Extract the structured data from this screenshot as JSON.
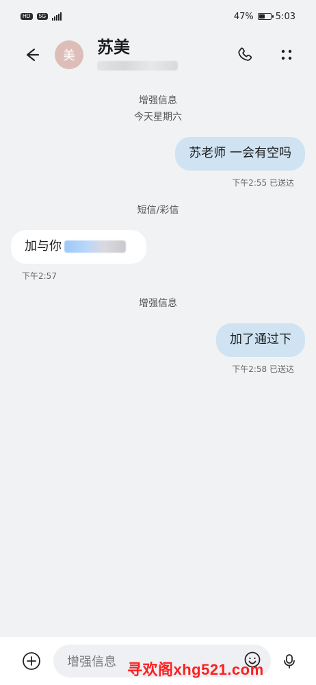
{
  "status_bar": {
    "hd": "HD",
    "network": "5G",
    "battery_percent": "47%",
    "time": "5:03",
    "battery_level": 0.47
  },
  "header": {
    "back_icon": "back-arrow-icon",
    "avatar_text": "美",
    "contact_name": "苏美",
    "phone_icon": "phone-icon",
    "more_icon": "more-vertical-icon",
    "avatar_color": "#dcbdb7"
  },
  "chat": {
    "labels": {
      "channel_enhanced_1": "增强信息",
      "day_label": "今天星期六",
      "channel_sms_mms": "短信/彩信",
      "channel_enhanced_2": "增强信息"
    },
    "messages": [
      {
        "direction": "outgoing",
        "text": "苏老师 一会有空吗",
        "meta": "下午2:55  已送达"
      },
      {
        "direction": "incoming",
        "text": "加与你",
        "meta": "下午2:57"
      },
      {
        "direction": "outgoing",
        "text": "加了通过下",
        "meta": "下午2:58  已送达"
      }
    ],
    "colors": {
      "outgoing_bubble": "#cfe3f2",
      "incoming_bubble": "#ffffff",
      "background": "#f1f2f4"
    }
  },
  "composer": {
    "plus_icon": "plus-circle-icon",
    "placeholder": "增强信息",
    "emoji_icon": "emoji-icon",
    "mic_icon": "mic-icon",
    "watermark": "寻欢阁xhg521.com"
  }
}
